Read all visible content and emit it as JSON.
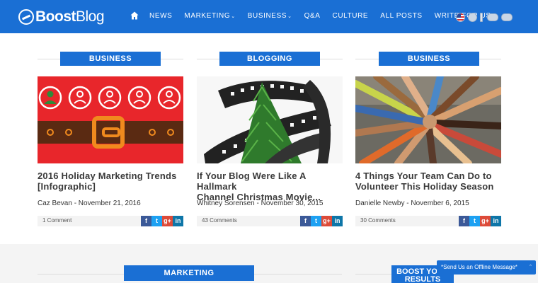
{
  "brand": {
    "logo_bold": "Boost",
    "logo_thin": "Blog"
  },
  "nav": {
    "home_icon": "home-icon",
    "items": [
      "News",
      "Marketing",
      "Business",
      "Q&A",
      "Culture",
      "All Posts",
      "Write For Us"
    ],
    "dropdown_items": [
      "Marketing",
      "Business"
    ]
  },
  "flags": [
    "us-flag",
    "language-flag",
    "language-flag",
    "language-flag"
  ],
  "posts": [
    {
      "category": "Business",
      "title_line1": "2016 Holiday Marketing Trends",
      "title_line2": "[Infographic]",
      "meta": "Caz Bevan - November 21, 2016",
      "comments": "1 Comment"
    },
    {
      "category": "Blogging",
      "title_line1": "If Your Blog Were Like A Hallmark",
      "title_line2": "Channel Christmas Movie...",
      "meta": "Whitney Sorensen - November 30, 2015",
      "comments": "43 Comments"
    },
    {
      "category": "Business",
      "title_line1": "4 Things Your Team Can Do to",
      "title_line2": "Volunteer This Holiday Season",
      "meta": "Danielle Newby - November 6, 2015",
      "comments": "30 Comments"
    }
  ],
  "share": {
    "fb": "f",
    "tw": "t",
    "gp": "g+",
    "in": "in"
  },
  "lower": {
    "marketing_label": "Marketing",
    "boost_label": "Boost Your Results"
  },
  "chat": {
    "label": "*Send Us an Offline Message*"
  },
  "colors": {
    "brand_blue": "#1a6fd4",
    "santa_red": "#e8262b",
    "belt_brown": "#5a2a12",
    "buckle_orange": "#f08a1e"
  }
}
